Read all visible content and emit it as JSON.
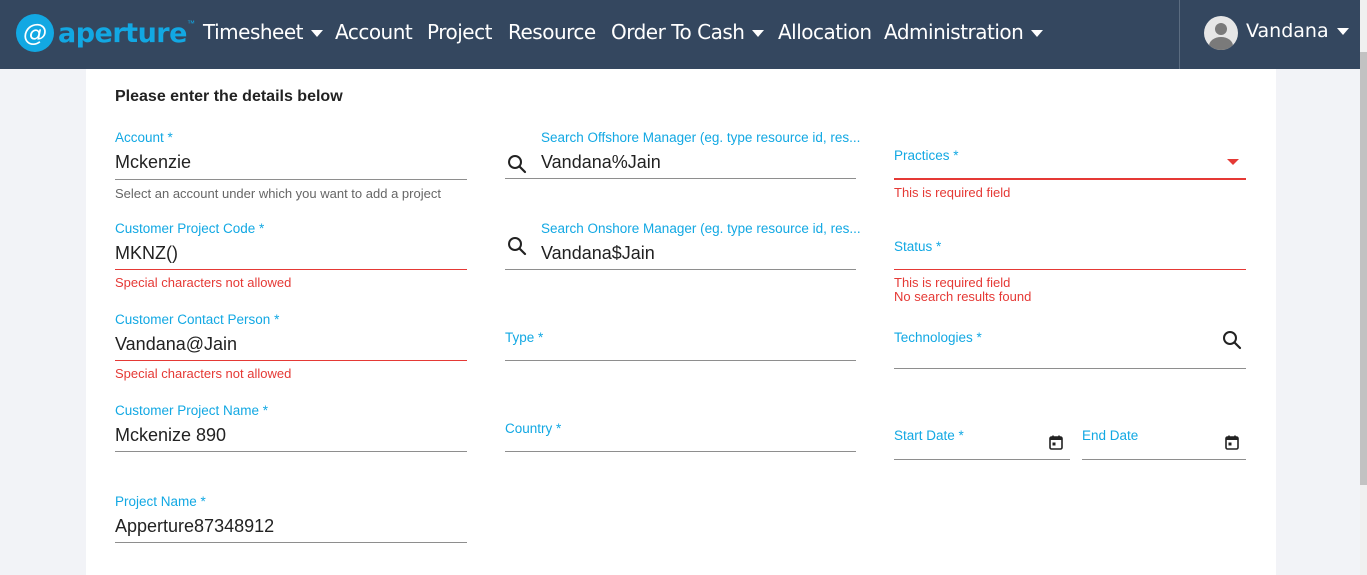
{
  "brand": {
    "name": "aperture",
    "mark": "@",
    "tm": "™"
  },
  "nav": [
    {
      "label": "Timesheet",
      "dropdown": true
    },
    {
      "label": "Account",
      "dropdown": false
    },
    {
      "label": "Project",
      "dropdown": false
    },
    {
      "label": "Resource",
      "dropdown": false
    },
    {
      "label": "Order To Cash",
      "dropdown": true
    },
    {
      "label": "Allocation",
      "dropdown": false
    },
    {
      "label": "Administration",
      "dropdown": true
    }
  ],
  "user": {
    "name": "Vandana"
  },
  "form": {
    "title": "Please enter the details below",
    "account": {
      "label": "Account *",
      "value": "Mckenzie",
      "hint": "Select an account under which you want to add a project"
    },
    "customer_project_code": {
      "label": "Customer Project Code *",
      "value": "MKNZ()",
      "error": "Special characters not allowed"
    },
    "customer_contact_person": {
      "label": "Customer Contact Person *",
      "value": "Vandana@Jain",
      "error": "Special characters not allowed"
    },
    "customer_project_name": {
      "label": "Customer Project Name *",
      "value": "Mckenize 890"
    },
    "project_name": {
      "label": "Project Name *",
      "value": "Apperture87348912"
    },
    "offshore_manager": {
      "label": "Search Offshore Manager (eg. type resource id, res...",
      "value": "Vandana%Jain"
    },
    "onshore_manager": {
      "label": "Search Onshore Manager (eg. type resource id, res...",
      "value": "Vandana$Jain"
    },
    "type": {
      "label": "Type *",
      "value": ""
    },
    "country": {
      "label": "Country *",
      "value": ""
    },
    "practices": {
      "label": "Practices *",
      "value": "",
      "error": "This is required field"
    },
    "status": {
      "label": "Status *",
      "value": "",
      "error": "This is required field",
      "error2": "No search results found"
    },
    "technologies": {
      "label": "Technologies *",
      "value": ""
    },
    "start_date": {
      "label": "Start Date *",
      "value": ""
    },
    "end_date": {
      "label": "End Date",
      "value": ""
    }
  },
  "icons": {
    "search": "search-icon",
    "calendar": "calendar-icon",
    "dropdown": "chevron-down-icon"
  },
  "colors": {
    "navbar": "#34475f",
    "accent": "#12a8e3",
    "error": "#e53935"
  }
}
